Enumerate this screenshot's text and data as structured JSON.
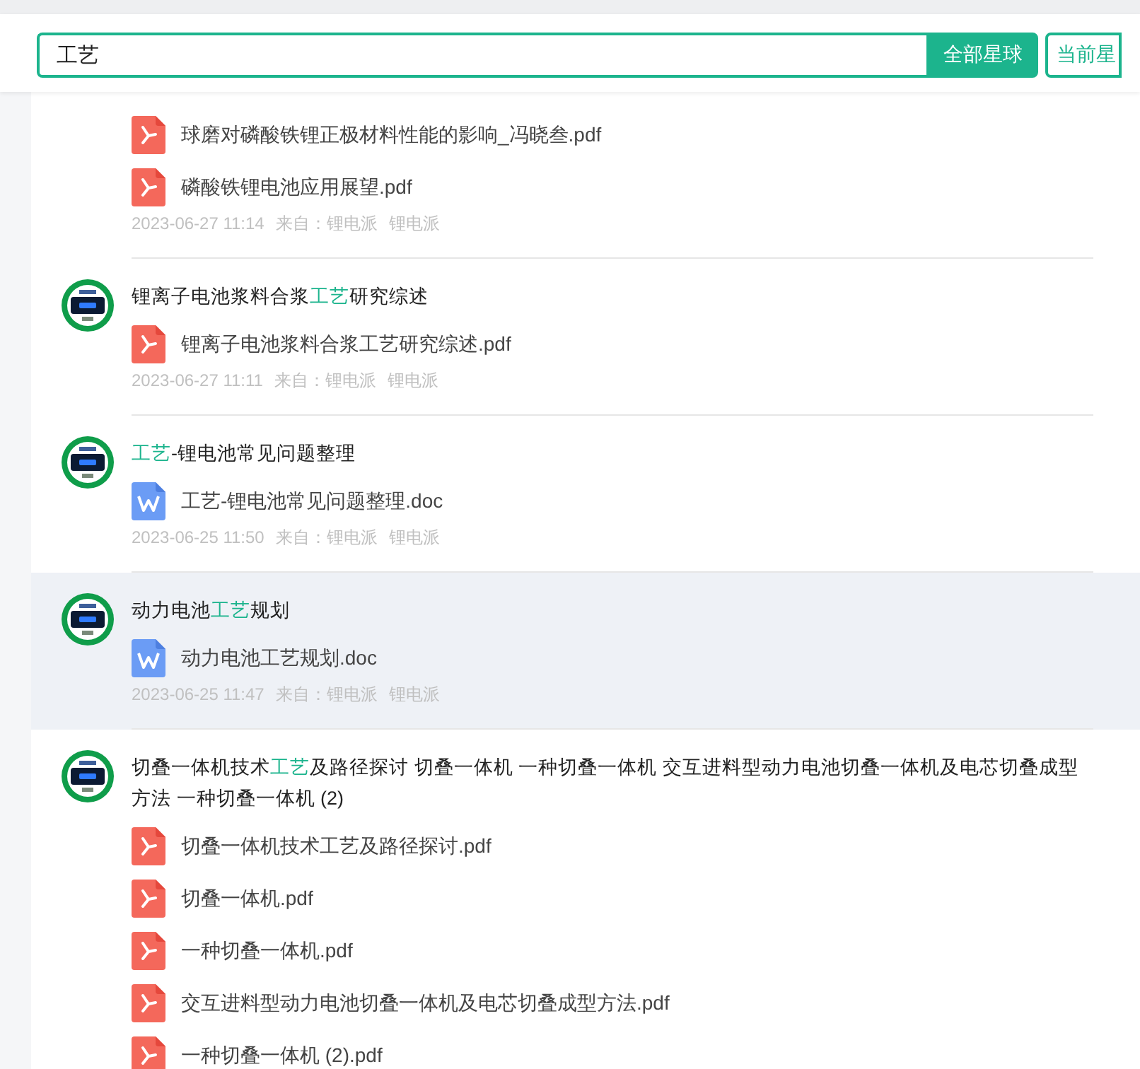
{
  "search": {
    "value": "工艺",
    "buttons": [
      {
        "label": "全部星球",
        "selected": true
      },
      {
        "label": "当前星",
        "selected": false
      }
    ]
  },
  "results": [
    {
      "highlighted": false,
      "files": [
        {
          "kind": "pdf",
          "name": "球磨对磷酸铁锂正极材料性能的影响_冯晓叁.pdf"
        },
        {
          "kind": "pdf",
          "name": "磷酸铁锂电池应用展望.pdf"
        }
      ],
      "time": "2023-06-27 11:14",
      "from": "来自：锂电派",
      "group": "锂电派"
    },
    {
      "highlighted": false,
      "title": [
        {
          "text": "锂离子电池浆料合浆",
          "match": false
        },
        {
          "text": "工艺",
          "match": true
        },
        {
          "text": "研究综述",
          "match": false
        }
      ],
      "files": [
        {
          "kind": "pdf",
          "name": "锂离子电池浆料合浆工艺研究综述.pdf"
        }
      ],
      "time": "2023-06-27 11:11",
      "from": "来自：锂电派",
      "group": "锂电派"
    },
    {
      "highlighted": false,
      "title": [
        {
          "text": "工艺",
          "match": true
        },
        {
          "text": "-锂电池常见问题整理",
          "match": false
        }
      ],
      "files": [
        {
          "kind": "doc",
          "name": "工艺-锂电池常见问题整理.doc"
        }
      ],
      "time": "2023-06-25 11:50",
      "from": "来自：锂电派",
      "group": "锂电派"
    },
    {
      "highlighted": true,
      "title": [
        {
          "text": "动力电池",
          "match": false
        },
        {
          "text": "工艺",
          "match": true
        },
        {
          "text": "规划",
          "match": false
        }
      ],
      "files": [
        {
          "kind": "doc",
          "name": "动力电池工艺规划.doc"
        }
      ],
      "time": "2023-06-25 11:47",
      "from": "来自：锂电派",
      "group": "锂电派"
    },
    {
      "highlighted": false,
      "title": [
        {
          "text": "切叠一体机技术",
          "match": false
        },
        {
          "text": "工艺",
          "match": true
        },
        {
          "text": "及路径探讨 切叠一体机 一种切叠一体机 交互进料型动力电池切叠一体机及电芯切叠成型方法 一种切叠一体机 (2)",
          "match": false
        }
      ],
      "files": [
        {
          "kind": "pdf",
          "name": "切叠一体机技术工艺及路径探讨.pdf"
        },
        {
          "kind": "pdf",
          "name": "切叠一体机.pdf"
        },
        {
          "kind": "pdf",
          "name": "一种切叠一体机.pdf"
        },
        {
          "kind": "pdf",
          "name": "交互进料型动力电池切叠一体机及电芯切叠成型方法.pdf"
        },
        {
          "kind": "pdf",
          "name": "一种切叠一体机 (2).pdf"
        }
      ]
    }
  ]
}
